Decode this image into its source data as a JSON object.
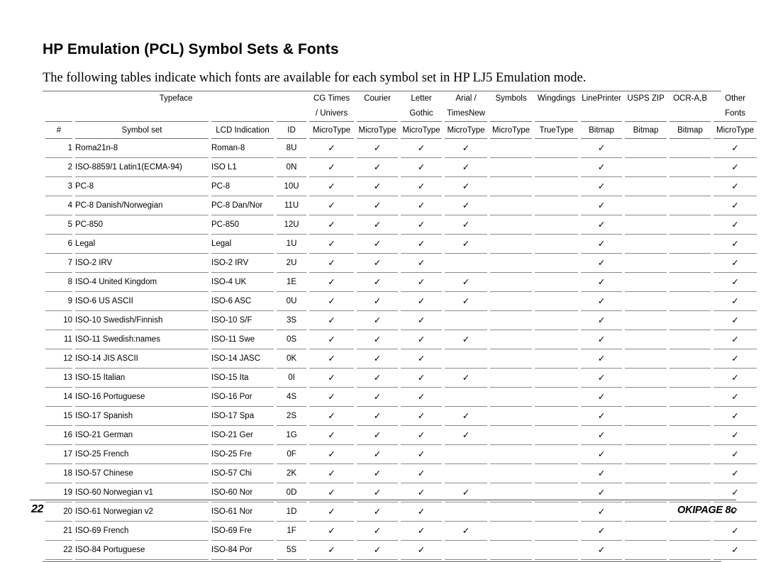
{
  "document": {
    "title": "HP Emulation (PCL) Symbol Sets & Fonts",
    "intro": "The following tables indicate which fonts are available for each symbol set in HP LJ5 Emulation mode."
  },
  "footer": {
    "page_number": "22",
    "product": "OKIPAGE 8c"
  },
  "table": {
    "group_header": "Typeface",
    "columns": [
      {
        "id": "num",
        "line1": "",
        "line2": "",
        "sub": "#"
      },
      {
        "id": "symbolset",
        "line1": "",
        "line2": "",
        "sub": "Symbol  set"
      },
      {
        "id": "lcd",
        "line1": "",
        "line2": "",
        "sub": "LCD Indication"
      },
      {
        "id": "idcode",
        "line1": "",
        "line2": "",
        "sub": "ID"
      },
      {
        "id": "cgtimes",
        "line1": "CG Times",
        "line2": "/ Univers",
        "sub": "MicroType"
      },
      {
        "id": "courier",
        "line1": "Courier",
        "line2": "",
        "sub": "MicroType"
      },
      {
        "id": "lettergothic",
        "line1": "Letter",
        "line2": "Gothic",
        "sub": "MicroType"
      },
      {
        "id": "arial",
        "line1": "Arial /",
        "line2": "TimesNew",
        "sub": "MicroType"
      },
      {
        "id": "symbols",
        "line1": "Symbols",
        "line2": "",
        "sub": "MicroType"
      },
      {
        "id": "wingdings",
        "line1": "Wingdings",
        "line2": "",
        "sub": "TrueType"
      },
      {
        "id": "lineprinter",
        "line1": "LinePrinter",
        "line2": "",
        "sub": "Bitmap"
      },
      {
        "id": "uspszip",
        "line1": "USPS ZIP",
        "line2": "",
        "sub": "Bitmap"
      },
      {
        "id": "ocrab",
        "line1": "OCR-A,B",
        "line2": "",
        "sub": "Bitmap"
      },
      {
        "id": "otherfonts",
        "line1": "Other",
        "line2": "Fonts",
        "sub": "MicroType"
      }
    ],
    "check_glyph": "✓",
    "rows": [
      {
        "num": "1",
        "symbolset": "Roma21n-8",
        "lcd": "Roman-8",
        "idcode": "8U",
        "checks": [
          true,
          true,
          true,
          true,
          false,
          false,
          true,
          false,
          false,
          true
        ]
      },
      {
        "num": "2",
        "symbolset": "ISO-8859/1  Latin1(ECMA-94)",
        "lcd": "ISO L1",
        "idcode": "0N",
        "checks": [
          true,
          true,
          true,
          true,
          false,
          false,
          true,
          false,
          false,
          true
        ]
      },
      {
        "num": "3",
        "symbolset": "PC-8",
        "lcd": "PC-8",
        "idcode": "10U",
        "checks": [
          true,
          true,
          true,
          true,
          false,
          false,
          true,
          false,
          false,
          true
        ]
      },
      {
        "num": "4",
        "symbolset": "PC-8  Danish/Norwegian",
        "lcd": "PC-8 Dan/Nor",
        "idcode": "11U",
        "checks": [
          true,
          true,
          true,
          true,
          false,
          false,
          true,
          false,
          false,
          true
        ]
      },
      {
        "num": "5",
        "symbolset": "PC-850",
        "lcd": "PC-850",
        "idcode": "12U",
        "checks": [
          true,
          true,
          true,
          true,
          false,
          false,
          true,
          false,
          false,
          true
        ]
      },
      {
        "num": "6",
        "symbolset": "Legal",
        "lcd": "Legal",
        "idcode": "1U",
        "checks": [
          true,
          true,
          true,
          true,
          false,
          false,
          true,
          false,
          false,
          true
        ]
      },
      {
        "num": "7",
        "symbolset": "ISO-2 IRV",
        "lcd": "ISO-2 IRV",
        "idcode": "2U",
        "checks": [
          true,
          true,
          true,
          false,
          false,
          false,
          true,
          false,
          false,
          true
        ]
      },
      {
        "num": "8",
        "symbolset": "ISO-4 United Kingdom",
        "lcd": "ISO-4 UK",
        "idcode": "1E",
        "checks": [
          true,
          true,
          true,
          true,
          false,
          false,
          true,
          false,
          false,
          true
        ]
      },
      {
        "num": "9",
        "symbolset": "ISO-6 US ASCII",
        "lcd": "ISO-6 ASC",
        "idcode": "0U",
        "checks": [
          true,
          true,
          true,
          true,
          false,
          false,
          true,
          false,
          false,
          true
        ]
      },
      {
        "num": "10",
        "symbolset": "ISO-10 Swedish/Finnish",
        "lcd": "ISO-10 S/F",
        "idcode": "3S",
        "checks": [
          true,
          true,
          true,
          false,
          false,
          false,
          true,
          false,
          false,
          true
        ]
      },
      {
        "num": "11",
        "symbolset": "ISO-11 Swedish:names",
        "lcd": "ISO-11 Swe",
        "idcode": "0S",
        "checks": [
          true,
          true,
          true,
          true,
          false,
          false,
          true,
          false,
          false,
          true
        ]
      },
      {
        "num": "12",
        "symbolset": "ISO-14 JIS ASCII",
        "lcd": "ISO-14 JASC",
        "idcode": "0K",
        "checks": [
          true,
          true,
          true,
          false,
          false,
          false,
          true,
          false,
          false,
          true
        ]
      },
      {
        "num": "13",
        "symbolset": "ISO-15 Italian",
        "lcd": "ISO-15 Ita",
        "idcode": "0I",
        "checks": [
          true,
          true,
          true,
          true,
          false,
          false,
          true,
          false,
          false,
          true
        ]
      },
      {
        "num": "14",
        "symbolset": "ISO-16 Portuguese",
        "lcd": "ISO-16 Por",
        "idcode": "4S",
        "checks": [
          true,
          true,
          true,
          false,
          false,
          false,
          true,
          false,
          false,
          true
        ]
      },
      {
        "num": "15",
        "symbolset": "ISO-17 Spanish",
        "lcd": "ISO-17 Spa",
        "idcode": "2S",
        "checks": [
          true,
          true,
          true,
          true,
          false,
          false,
          true,
          false,
          false,
          true
        ]
      },
      {
        "num": "16",
        "symbolset": "ISO-21 German",
        "lcd": "ISO-21 Ger",
        "idcode": "1G",
        "checks": [
          true,
          true,
          true,
          true,
          false,
          false,
          true,
          false,
          false,
          true
        ]
      },
      {
        "num": "17",
        "symbolset": "ISO-25 French",
        "lcd": "ISO-25 Fre",
        "idcode": "0F",
        "checks": [
          true,
          true,
          true,
          false,
          false,
          false,
          true,
          false,
          false,
          true
        ]
      },
      {
        "num": "18",
        "symbolset": "ISO-57 Chinese",
        "lcd": "ISO-57 Chi",
        "idcode": "2K",
        "checks": [
          true,
          true,
          true,
          false,
          false,
          false,
          true,
          false,
          false,
          true
        ]
      },
      {
        "num": "19",
        "symbolset": "ISO-60 Norwegian v1",
        "lcd": "ISO-60 Nor",
        "idcode": "0D",
        "checks": [
          true,
          true,
          true,
          true,
          false,
          false,
          true,
          false,
          false,
          true
        ]
      },
      {
        "num": "20",
        "symbolset": "ISO-61 Norwegian  v2",
        "lcd": "ISO-61 Nor",
        "idcode": "1D",
        "checks": [
          true,
          true,
          true,
          false,
          false,
          false,
          true,
          false,
          false,
          true
        ]
      },
      {
        "num": "21",
        "symbolset": "ISO-69 French",
        "lcd": "ISO-69 Fre",
        "idcode": "1F",
        "checks": [
          true,
          true,
          true,
          true,
          false,
          false,
          true,
          false,
          false,
          true
        ]
      },
      {
        "num": "22",
        "symbolset": "ISO-84 Portuguese",
        "lcd": "ISO-84 Por",
        "idcode": "5S",
        "checks": [
          true,
          true,
          true,
          false,
          false,
          false,
          true,
          false,
          false,
          true
        ]
      }
    ]
  }
}
